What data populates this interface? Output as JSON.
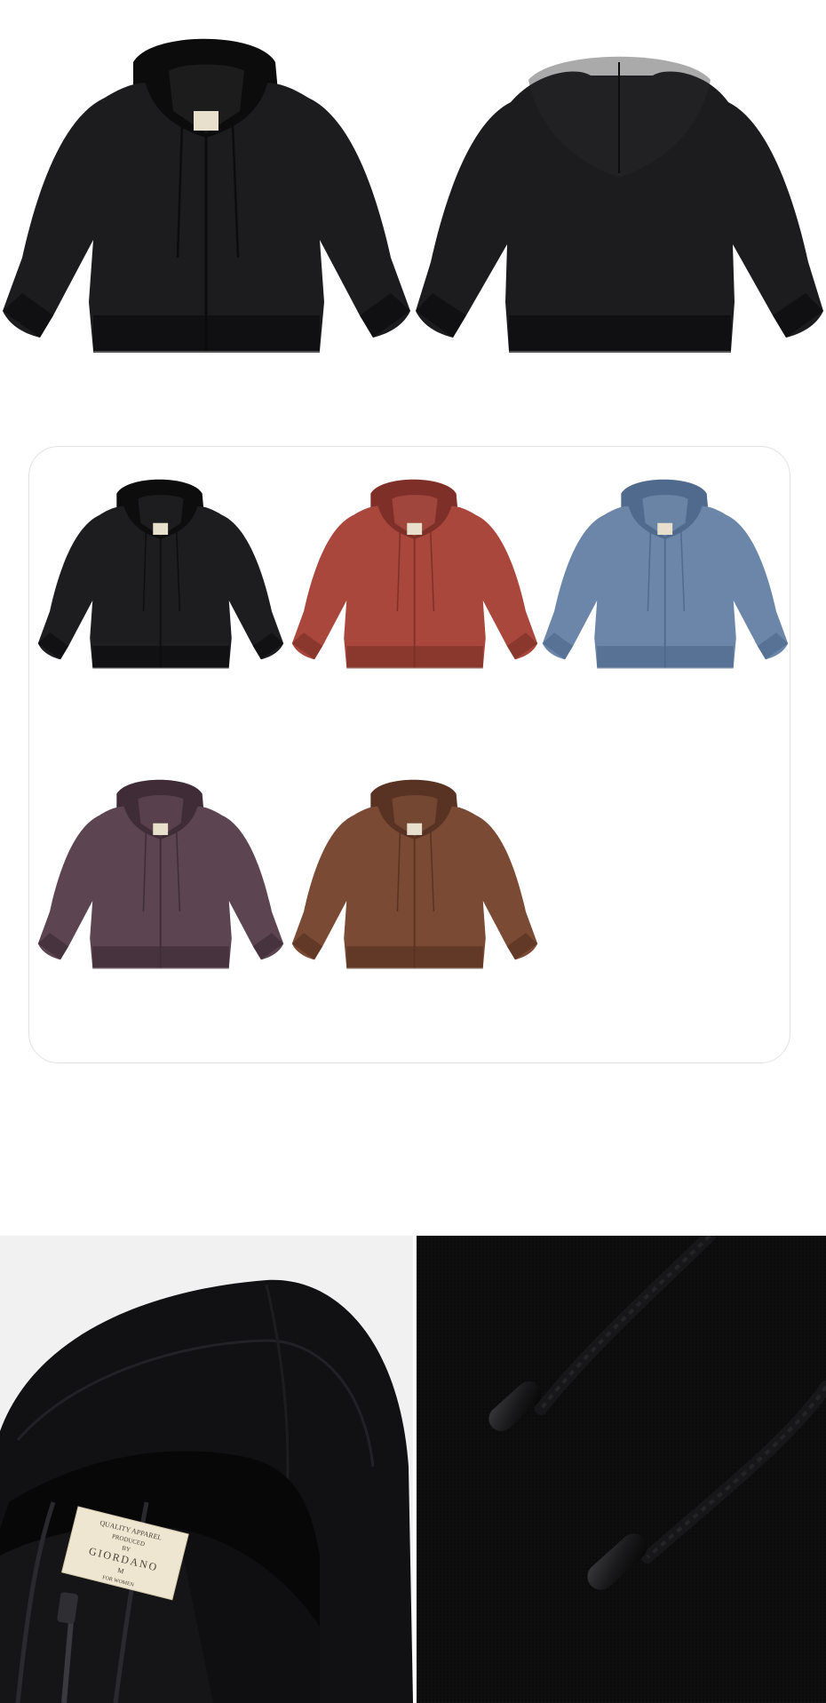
{
  "product_views": [
    {
      "name": "front",
      "color": "#1c1c1e"
    },
    {
      "name": "back",
      "color": "#1c1c1e"
    }
  ],
  "color_swatches": [
    {
      "name": "black",
      "color": "#1d1d1f",
      "shade": "#0d0d0e",
      "light": "#2c2c2e"
    },
    {
      "name": "rust",
      "color": "#a9473c",
      "shade": "#7e3028",
      "light": "#bb5a4e"
    },
    {
      "name": "blue",
      "color": "#6b86a8",
      "shade": "#4f6a8c",
      "light": "#7f99b8"
    },
    {
      "name": "plum",
      "color": "#5c4450",
      "shade": "#3f2c36",
      "light": "#6d5460"
    },
    {
      "name": "brown",
      "color": "#7a4a34",
      "shade": "#583222",
      "light": "#8c5a42"
    }
  ],
  "label_tag": {
    "line1": "QUALITY APPAREL",
    "line2": "PRODUCED",
    "line3": "BY",
    "brand": "GIORDANO",
    "size": "M",
    "line6": "FOR WOMEN"
  }
}
